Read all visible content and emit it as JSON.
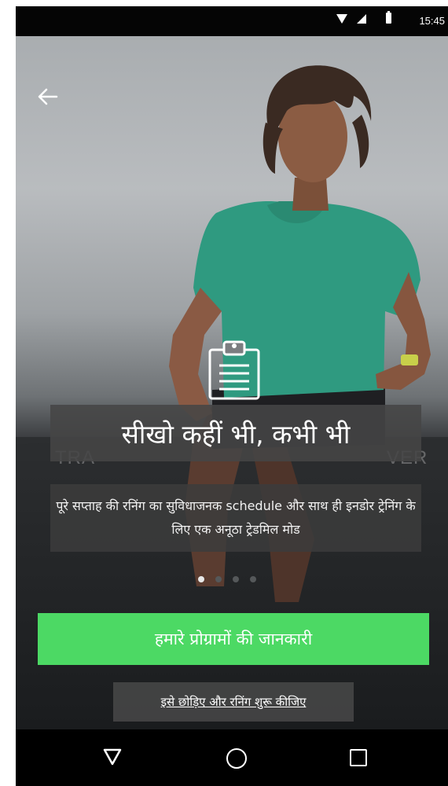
{
  "status_bar": {
    "time": "15:45",
    "icons": [
      "wifi-icon",
      "signal-icon",
      "battery-icon"
    ]
  },
  "header": {
    "back_icon": "arrow-left-icon"
  },
  "slide": {
    "icon": "clipboard-icon",
    "background_watermark_left": "TRA",
    "background_watermark_right": "VER",
    "headline": "सीखो कहीं भी, कभी भी",
    "description": "पूरे सप्ताह की रनिंग का सुविधाजनक schedule और साथ ही इनडोर ट्रेनिंग के लिए एक अनूठा ट्रेडमिल मोड"
  },
  "pagination": {
    "total": 4,
    "active_index": 0
  },
  "actions": {
    "primary_label": "हमारे प्रोग्रामों की जानकारी",
    "skip_label": "इसे छोड़िए और रनिंग शुरू कीजिए"
  },
  "colors": {
    "primary_button": "#4cd964",
    "text_box_bg": "#464646",
    "status_bar_bg": "#050505",
    "nav_bar_bg": "#000000"
  },
  "nav_bar": {
    "icons": [
      "nav-back-icon",
      "nav-home-icon",
      "nav-recents-icon"
    ]
  }
}
